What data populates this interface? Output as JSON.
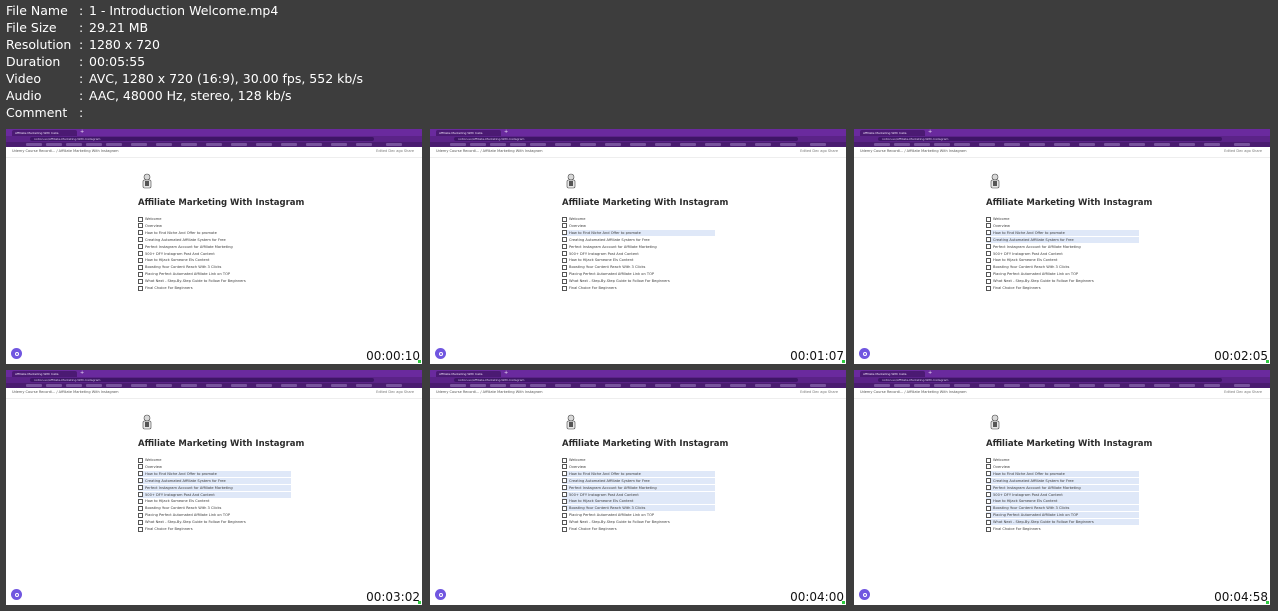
{
  "info": [
    {
      "key": "File Name",
      "value": "1 - Introduction Welcome.mp4"
    },
    {
      "key": "File Size",
      "value": "29.21 MB"
    },
    {
      "key": "Resolution",
      "value": "1280 x 720"
    },
    {
      "key": "Duration",
      "value": "00:05:55"
    },
    {
      "key": "Video",
      "value": "AVC, 1280 x 720 (16:9), 30.00 fps, 552 kb/s"
    },
    {
      "key": "Audio",
      "value": "AAC, 48000 Hz, stereo, 128 kb/s"
    },
    {
      "key": "Comment",
      "value": ""
    }
  ],
  "separator": ":",
  "page": {
    "tab_title": "Affiliate Marketing With Insta",
    "url": "notion.so/Affiliate-Marketing-With-Instagram",
    "breadcrumb": "Udemy Course Recordi... / Affiliate Marketing With Instagram",
    "controls": "Edited Dec ago   Share",
    "title": "Affiliate Marketing With Instagram",
    "checklist": [
      "Welcome",
      "Overview",
      "How to Find Niche And Offer to promote",
      "Creating Automated Affiliate System for Free",
      "Perfect Instagram Account for Affiliate Marketing",
      "500+ DFY Instagram Post And Content",
      "How to Hijack Someone Els Content",
      "Boosting Your Content Reach With 3 Clicks",
      "Placing Perfect Automated Affiliate Link on TOP",
      "What Next - Step-By-Step Guide to Follow For Beginners",
      "Final Choice For Beginners"
    ]
  },
  "thumbnails": [
    {
      "timestamp": "00:00:10",
      "highlighted": []
    },
    {
      "timestamp": "00:01:07",
      "highlighted": [
        2
      ]
    },
    {
      "timestamp": "00:02:05",
      "highlighted": [
        2,
        3
      ]
    },
    {
      "timestamp": "00:03:02",
      "highlighted": [
        2,
        3,
        4,
        5
      ]
    },
    {
      "timestamp": "00:04:00",
      "highlighted": [
        2,
        3,
        4,
        5,
        6,
        7
      ]
    },
    {
      "timestamp": "00:04:58",
      "highlighted": [
        2,
        3,
        4,
        5,
        6,
        7,
        8,
        9
      ]
    }
  ]
}
